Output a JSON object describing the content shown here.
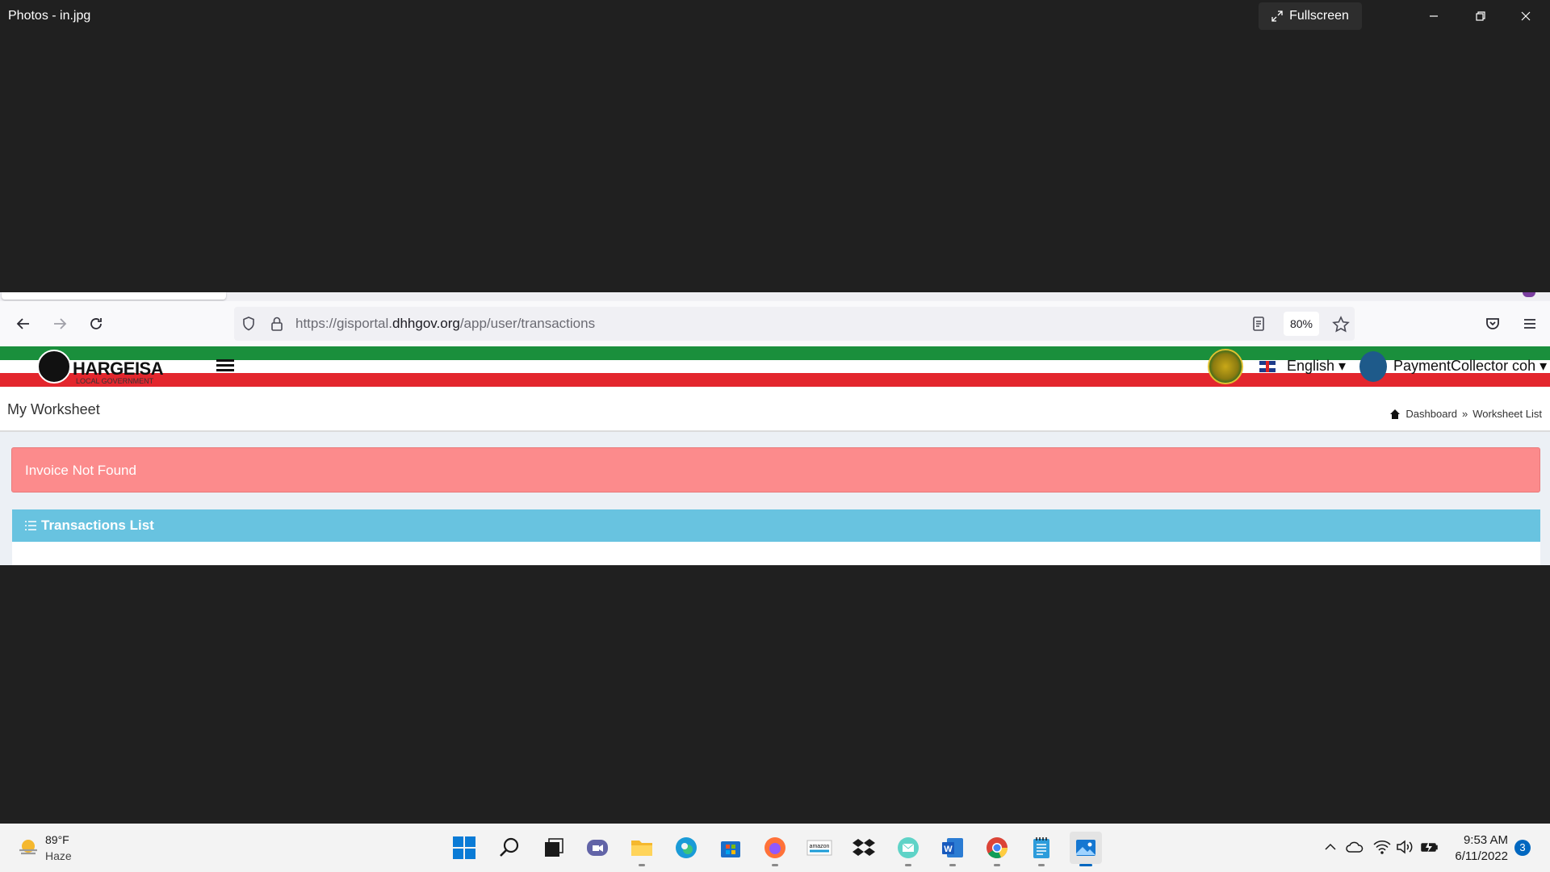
{
  "photos_app": {
    "title": "Photos - in.jpg",
    "fullscreen_label": "Fullscreen"
  },
  "browser": {
    "url_prefix": "https://gisportal.",
    "url_domain": "dhhgov.org",
    "url_path": "/app/user/transactions",
    "zoom": "80%"
  },
  "site": {
    "logo_text": "HARGEISA",
    "logo_sub": "LOCAL GOVERNMENT",
    "language": "English",
    "user": "PaymentCollector coh",
    "page_title": "My Worksheet",
    "breadcrumb": {
      "home": "Dashboard",
      "separator": "»",
      "current": "Worksheet List"
    },
    "alert": "Invoice Not Found",
    "box_title": "Transactions List",
    "colors": {
      "green": "#1a8f3c",
      "red": "#e3262d",
      "alert": "#fc8b8c",
      "box_header": "#68c3e0"
    }
  },
  "taskbar": {
    "weather_temp": "89°F",
    "weather_desc": "Haze",
    "time": "9:53 AM",
    "date": "6/11/2022",
    "notification_count": "3",
    "apps": [
      "windows-start",
      "search",
      "task-view",
      "teams-chat",
      "file-explorer",
      "edge",
      "microsoft-store",
      "firefox",
      "amazon",
      "dropbox",
      "mail",
      "word",
      "chrome",
      "notepad",
      "photos"
    ]
  }
}
